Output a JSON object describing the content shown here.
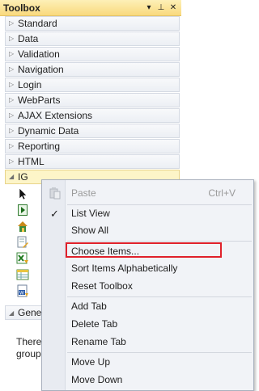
{
  "toolbox": {
    "title": "Toolbox",
    "buttons": {
      "dropdown_glyph": "▾",
      "pin_glyph": "⊥",
      "close_glyph": "✕"
    },
    "categories": [
      {
        "label": "Standard"
      },
      {
        "label": "Data"
      },
      {
        "label": "Validation"
      },
      {
        "label": "Navigation"
      },
      {
        "label": "Login"
      },
      {
        "label": "WebParts"
      },
      {
        "label": "AJAX Extensions"
      },
      {
        "label": "Dynamic Data"
      },
      {
        "label": "Reporting"
      },
      {
        "label": "HTML"
      },
      {
        "label": "IG"
      }
    ],
    "general_tab": {
      "label": "General"
    },
    "empty_note": {
      "line1": "There",
      "line2": "group."
    }
  },
  "context_menu": {
    "items": [
      {
        "label": "Paste",
        "shortcut": "Ctrl+V",
        "disabled": true
      },
      {
        "label": "List View",
        "checked": true
      },
      {
        "label": "Show All"
      },
      {
        "label": "Choose Items...",
        "highlighted": true
      },
      {
        "label": "Sort Items Alphabetically"
      },
      {
        "label": "Reset Toolbox"
      },
      {
        "label": "Add Tab"
      },
      {
        "label": "Delete Tab"
      },
      {
        "label": "Rename Tab"
      },
      {
        "label": "Move Up"
      },
      {
        "label": "Move Down"
      }
    ]
  },
  "colors": {
    "title_bar": "#f9d97d",
    "highlight_outline": "#e0202a",
    "menu_background": "#f1f3f7"
  }
}
